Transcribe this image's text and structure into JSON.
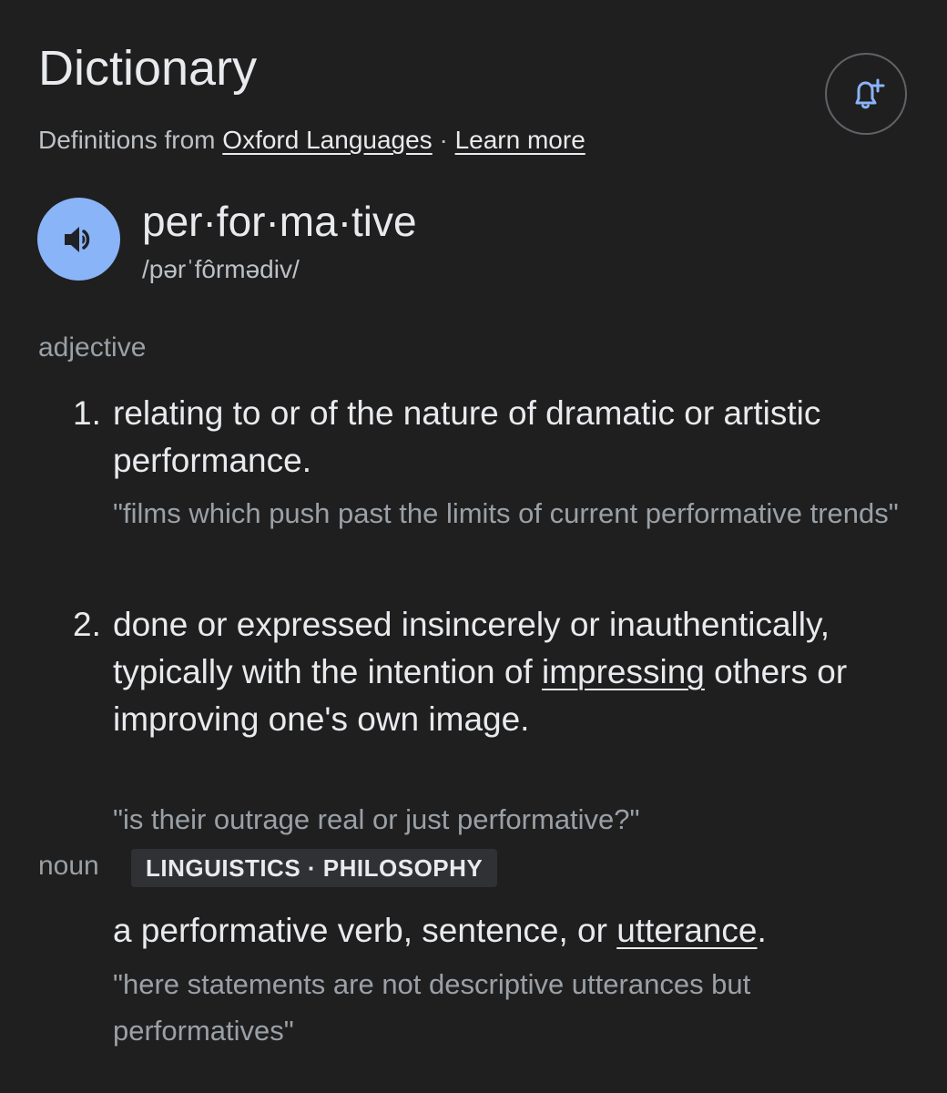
{
  "header": {
    "title": "Dictionary",
    "source_prefix": "Definitions from",
    "source_link": "Oxford Languages",
    "separator": "·",
    "learn_more": "Learn more"
  },
  "entry": {
    "headword": "per·for·ma·tive",
    "phonetic": "/pərˈfôrmədiv/"
  },
  "adjective": {
    "label": "adjective",
    "senses": [
      {
        "number": "1.",
        "definition": "relating to or of the nature of dramatic or artistic performance.",
        "example": "\"films which push past the limits of current performative trends\""
      },
      {
        "number": "2.",
        "definition_before": "done or expressed insincerely or inauthentically, typically with the intention of",
        "definition_link": "impressing",
        "definition_after": "others or improving one's own image.",
        "example": "\"is their outrage real or just performative?\""
      }
    ]
  },
  "noun": {
    "label": "noun",
    "tag": "LINGUISTICS · PHILOSOPHY",
    "definition_before": "a performative verb, sentence, or",
    "definition_link": "utterance",
    "definition_after": ".",
    "example": "\"here statements are not descriptive utterances but performatives\""
  },
  "icons": {
    "alert": "bell-plus-icon",
    "audio": "speaker-icon"
  },
  "colors": {
    "background": "#1f1f1f",
    "accent": "#8ab4f8",
    "text_primary": "#e8eaed",
    "text_secondary": "#9aa0a6"
  }
}
